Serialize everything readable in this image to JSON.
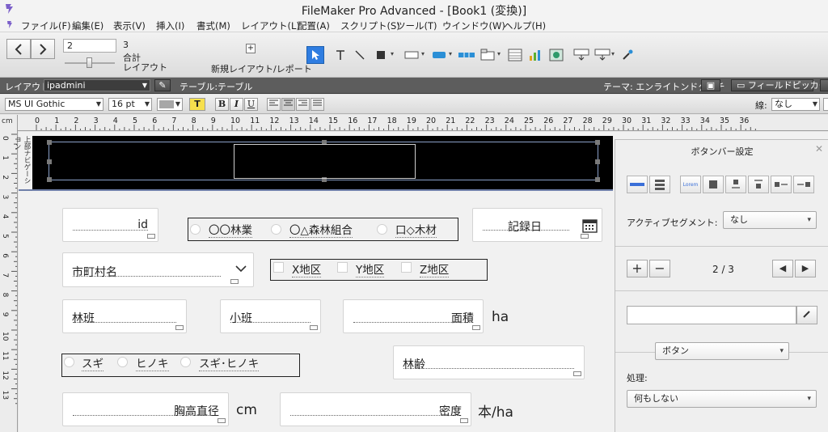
{
  "window": {
    "title": "FileMaker Pro Advanced - [Book1 (変換)]"
  },
  "menu": [
    "ファイル(F)",
    "編集(E)",
    "表示(V)",
    "挿入(I)",
    "書式(M)",
    "レイアウト(L)",
    "配置(A)",
    "スクリプト(S)",
    "ツール(T)",
    "ウインドウ(W)",
    "ヘルプ(H)"
  ],
  "toolbar": {
    "page_value": "2",
    "page_total": "3",
    "total_label": "合計",
    "layout_label": "レイアウト",
    "new_layout_label": "新規レイアウト/レポート"
  },
  "layoutbar": {
    "layout_label": "レイアウト:",
    "layout_value": "ipadmini",
    "table_label": "テーブル:テーブル",
    "theme_label": "テーマ: エンライトンドタッチ",
    "field_picker": "フィールドピッカー"
  },
  "formatbar": {
    "font": "MS UI Gothic",
    "size": "16 pt",
    "bold": "B",
    "italic": "I",
    "underline": "U",
    "highlight": "T",
    "line_label": "線:",
    "line_value": "なし"
  },
  "ruler": {
    "unit": "cm",
    "h_numbers": [
      "0",
      "1",
      "2",
      "3",
      "4",
      "5",
      "6",
      "7",
      "8",
      "9",
      "10",
      "11",
      "12",
      "13",
      "14",
      "15",
      "16",
      "17",
      "18",
      "19",
      "20",
      "21",
      "22",
      "23",
      "24",
      "25",
      "26",
      "27",
      "28",
      "29",
      "30",
      "31",
      "32",
      "33",
      "34",
      "35",
      "36"
    ],
    "v_numbers": [
      "0",
      "1",
      "2",
      "3",
      "4",
      "5",
      "6",
      "7",
      "8",
      "9",
      "10",
      "11",
      "12",
      "13"
    ]
  },
  "band_label": "上部ナビゲーション",
  "fields": {
    "id": "id",
    "record_date": "記録日",
    "municipality": "市町村名",
    "forest_group": "林班",
    "sub_group": "小班",
    "area": "面積",
    "area_unit": "ha",
    "age": "林齢",
    "dbh": "胸高直径",
    "dbh_unit": "cm",
    "density": "密度",
    "density_unit": "本/ha"
  },
  "org_radios": [
    "〇〇林業",
    "〇△森林組合",
    "口◇木材"
  ],
  "district_checks": [
    "X地区",
    "Y地区",
    "Z地区"
  ],
  "species_radios": [
    "スギ",
    "ヒノキ",
    "スギ･ヒノキ"
  ],
  "panel": {
    "title": "ボタンバー設定",
    "active_segment_label": "アクティブセグメント:",
    "active_segment_value": "なし",
    "pager": "2 / 3",
    "button_type": "ボタン",
    "action_label": "処理:",
    "action_value": "何もしない",
    "lorem": "Lorem"
  }
}
